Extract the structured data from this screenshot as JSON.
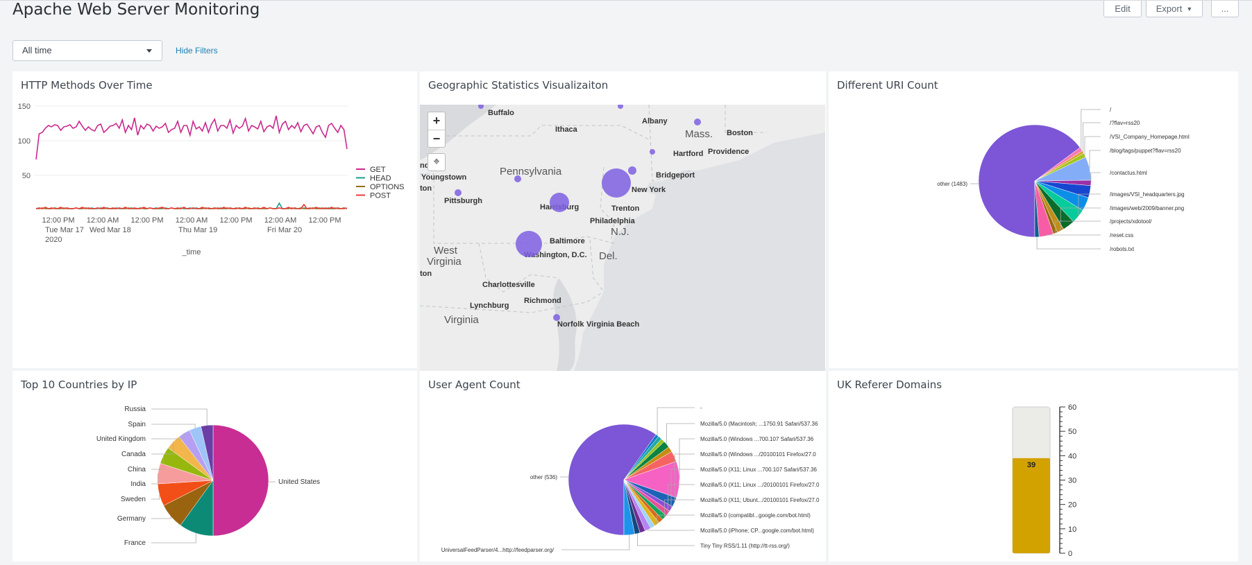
{
  "header": {
    "title": "Apache Web Server Monitoring",
    "edit_label": "Edit",
    "export_label": "Export",
    "more_label": "..."
  },
  "filters": {
    "time_range": "All time",
    "hide_filters": "Hide Filters"
  },
  "panels": {
    "http_methods": {
      "title": "HTTP Methods Over Time",
      "chart_data": {
        "type": "line",
        "xlabel": "_time",
        "ylabel": "",
        "ylim": [
          0,
          150
        ],
        "y_ticks": [
          "150",
          "100",
          "50"
        ],
        "x_ticks": [
          {
            "line1": "12:00 PM",
            "line2": "Tue Mar 17",
            "line3": "2020"
          },
          {
            "line1": "12:00 AM",
            "line2": "Wed Mar 18",
            "line3": ""
          },
          {
            "line1": "12:00 PM",
            "line2": "",
            "line3": ""
          },
          {
            "line1": "12:00 AM",
            "line2": "Thu Mar 19",
            "line3": ""
          },
          {
            "line1": "12:00 PM",
            "line2": "",
            "line3": ""
          },
          {
            "line1": "12:00 AM",
            "line2": "Fri Mar 20",
            "line3": ""
          },
          {
            "line1": "12:00 PM",
            "line2": "",
            "line3": ""
          }
        ],
        "legend_position": "right",
        "series": [
          {
            "name": "GET",
            "color": "#c8298e",
            "values": [
              73,
              110,
              112,
              118,
              122,
              120,
              123,
              122,
              115,
              120,
              121,
              123,
              118,
              120,
              128,
              121,
              115,
              120,
              116,
              114,
              122,
              124,
              112,
              116,
              121,
              122,
              125,
              118,
              130,
              112,
              122,
              116,
              133,
              108,
              122,
              117,
              124,
              122,
              114,
              121,
              118,
              120,
              125,
              112,
              116,
              118,
              128,
              112,
              122,
              122,
              108,
              128,
              117,
              120,
              114,
              126,
              112,
              124,
              131,
              114,
              122,
              122,
              118,
              130,
              111,
              122,
              118,
              121,
              132,
              114,
              122,
              120,
              117,
              128,
              113,
              120,
              122,
              118,
              136,
              112,
              124,
              128,
              116,
              122,
              118,
              126,
              113,
              122,
              124,
              117,
              110,
              120,
              122,
              112,
              105,
              122,
              125,
              118,
              112,
              122,
              116,
              88
            ]
          },
          {
            "name": "HEAD",
            "color": "#1a9c8f",
            "values": [
              2,
              3,
              2,
              3,
              2,
              2,
              3,
              2,
              3,
              2,
              3,
              2,
              2,
              3,
              2,
              2,
              3,
              2,
              3,
              2,
              2,
              3,
              2,
              3,
              2,
              2,
              3,
              2,
              2,
              3,
              2,
              3,
              2,
              2,
              3,
              2,
              2,
              3,
              2,
              3,
              2,
              2,
              3,
              2,
              3,
              2,
              2,
              3,
              2,
              2,
              3,
              2,
              3,
              2,
              2,
              3,
              2,
              2,
              3,
              2,
              3,
              2,
              2,
              3,
              2,
              2,
              3,
              2,
              3,
              2,
              2,
              3,
              2,
              2,
              3,
              2,
              3,
              2,
              2,
              10,
              2,
              2,
              3,
              2,
              3,
              2,
              2,
              3,
              2,
              2,
              3,
              2,
              3,
              2,
              2,
              3,
              2,
              2,
              3,
              2,
              3,
              2
            ]
          },
          {
            "name": "OPTIONS",
            "color": "#956e16",
            "values": [
              2,
              2,
              3,
              2,
              2,
              2,
              3,
              2,
              2,
              3,
              2,
              2,
              2,
              3,
              2,
              2,
              3,
              2,
              2,
              2,
              3,
              2,
              2,
              3,
              2,
              2,
              2,
              3,
              2,
              2,
              3,
              2,
              2,
              2,
              3,
              2,
              2,
              3,
              2,
              2,
              2,
              3,
              2,
              2,
              3,
              2,
              2,
              2,
              3,
              2,
              2,
              3,
              2,
              2,
              2,
              3,
              2,
              2,
              3,
              2,
              2,
              2,
              3,
              2,
              2,
              3,
              2,
              2,
              2,
              3,
              2,
              2,
              3,
              2,
              2,
              2,
              3,
              2,
              2,
              3,
              2,
              2,
              2,
              3,
              2,
              2,
              3,
              2,
              2,
              2,
              3,
              2,
              2,
              3,
              2,
              2,
              2,
              3,
              2,
              2,
              3,
              2
            ]
          },
          {
            "name": "POST",
            "color": "#ec3b37",
            "values": [
              2,
              3,
              2,
              4,
              2,
              3,
              2,
              2,
              4,
              2,
              3,
              2,
              2,
              3,
              2,
              4,
              2,
              3,
              2,
              2,
              3,
              2,
              4,
              2,
              2,
              3,
              2,
              3,
              2,
              4,
              2,
              2,
              3,
              2,
              2,
              4,
              2,
              3,
              2,
              2,
              3,
              4,
              2,
              2,
              3,
              2,
              3,
              2,
              4,
              2,
              2,
              3,
              2,
              2,
              4,
              2,
              3,
              2,
              2,
              3,
              2,
              4,
              2,
              3,
              2,
              2,
              3,
              2,
              4,
              2,
              2,
              3,
              2,
              2,
              4,
              2,
              3,
              2,
              2,
              3,
              2,
              2,
              4,
              2,
              3,
              2,
              2,
              8,
              2,
              3,
              2,
              4,
              2,
              2,
              3,
              2,
              4,
              2,
              3,
              2,
              2,
              3
            ]
          }
        ]
      }
    },
    "geo": {
      "title": "Geographic Statistics Visualizaiton",
      "zoom_in": "+",
      "zoom_out": "−",
      "locate_icon": "⌖",
      "labels": [
        "Buffalo",
        "Albany",
        "Ithaca",
        "Mass.",
        "Boston",
        "Hartford",
        "Providence",
        "Bridgeport",
        "New York",
        "Pennsylvania",
        "Youngstown",
        "Pittsburgh",
        "Harrisburg",
        "Trenton",
        "Philadelphia",
        "N.J.",
        "Baltimore",
        "Washington, D.C.",
        "Del.",
        "West",
        "Virginia",
        "Charlottesville",
        "Richmond",
        "Lynchburg",
        "Virginia",
        "Norfolk",
        "Virginia Beach",
        "nd",
        "ton",
        "ton"
      ]
    },
    "uri": {
      "title": "Different URI Count",
      "chart_data": {
        "type": "pie",
        "slices": [
          {
            "label": "other (1483)",
            "value": 1483,
            "color": "#7c56d6"
          },
          {
            "label": "/",
            "value": 26,
            "color": "#f979b5"
          },
          {
            "label": "/?flav=rss20",
            "value": 18,
            "color": "#d7a32c"
          },
          {
            "label": "/VSI_Company_Homepage.html",
            "value": 28,
            "color": "#a3c41e"
          },
          {
            "label": "/blog/tags/puppet?flav=rss20",
            "value": 155,
            "color": "#84adf7"
          },
          {
            "label": "/contactus.html",
            "value": 35,
            "color": "#9c2fa8"
          },
          {
            "label": "",
            "value": 80,
            "color": "#1747d0"
          },
          {
            "label": "",
            "value": 90,
            "color": "#0c8ee8"
          },
          {
            "label": "/images/VSI_headquarters.jpg",
            "value": 95,
            "color": "#08cb9b"
          },
          {
            "label": "",
            "value": 80,
            "color": "#0a6b2a"
          },
          {
            "label": "/images/web/2009/banner.png",
            "value": 45,
            "color": "#c08d1a"
          },
          {
            "label": "/projects/xdotool/",
            "value": 28,
            "color": "#9a6a0e"
          },
          {
            "label": "/reset.css",
            "value": 95,
            "color": "#f75da4"
          },
          {
            "label": "/robots.txt",
            "value": 28,
            "color": "#0d5f8f"
          }
        ]
      }
    },
    "countries": {
      "title": "Top 10 Countries by IP",
      "chart_data": {
        "type": "pie",
        "slices": [
          {
            "label": "United States",
            "value": 50,
            "color": "#c82d94"
          },
          {
            "label": "France",
            "value": 10,
            "color": "#0d8a76"
          },
          {
            "label": "Germany",
            "value": 7.5,
            "color": "#9a630f"
          },
          {
            "label": "Sweden",
            "value": 6.5,
            "color": "#f14f17"
          },
          {
            "label": "India",
            "value": 6,
            "color": "#f79c9c"
          },
          {
            "label": "China",
            "value": 5,
            "color": "#96b80e"
          },
          {
            "label": "Canada",
            "value": 4.5,
            "color": "#f3b64c"
          },
          {
            "label": "United Kingdom",
            "value": 3.5,
            "color": "#b69ff3"
          },
          {
            "label": "Spain",
            "value": 3.5,
            "color": "#9ec4f8"
          },
          {
            "label": "Russia",
            "value": 3.5,
            "color": "#6a3ea5"
          }
        ]
      }
    },
    "agents": {
      "title": "User Agent Count",
      "chart_data": {
        "type": "pie",
        "slices": [
          {
            "label": "other (536)",
            "value": 536,
            "color": "#7c56d6"
          },
          {
            "label": "-",
            "value": 8,
            "color": "#0d7fc8"
          },
          {
            "label": "",
            "value": 10,
            "color": "#1ea8a8"
          },
          {
            "label": "",
            "value": 10,
            "color": "#9bc225"
          },
          {
            "label": "Mozilla/5.0 (Macintosh; ...1750.91 Safari/537.36",
            "value": 18,
            "color": "#0b8342"
          },
          {
            "label": "",
            "value": 14,
            "color": "#c68d12"
          },
          {
            "label": "",
            "value": 28,
            "color": "#f56462"
          },
          {
            "label": "Mozilla/5.0 (Windows ...700.107 Safari/537.36",
            "value": 95,
            "color": "#f661c4"
          },
          {
            "label": "Mozilla/5.0 (Windows .../20100101 Firefox/27.0",
            "value": 25,
            "color": "#1c63b5"
          },
          {
            "label": "Mozilla/5.0 (X11; Linux ...700.107 Safari/537.36",
            "value": 14,
            "color": "#8e4fd7"
          },
          {
            "label": "Mozilla/5.0 (X11; Linux .../20100101 Firefox/27.0",
            "value": 14,
            "color": "#e65198"
          },
          {
            "label": "Mozilla/5.0 (X11; Ubunt.../20100101 Firefox/27.0",
            "value": 14,
            "color": "#14a45c"
          },
          {
            "label": "",
            "value": 12,
            "color": "#d96a1c"
          },
          {
            "label": "Mozilla/5.0 (compatibl...google.com/bot.html)",
            "value": 14,
            "color": "#dfb21f"
          },
          {
            "label": "",
            "value": 12,
            "color": "#a0d4f5"
          },
          {
            "label": "Mozilla/5.0 (iPhone; CP...google.com/bot.html)",
            "value": 16,
            "color": "#b484f2"
          },
          {
            "label": "",
            "value": 14,
            "color": "#6d2d93"
          },
          {
            "label": "Tiny Tiny RSS/1.11 (http://tt-rss.org/)",
            "value": 14,
            "color": "#16477e"
          },
          {
            "label": "UniversalFeedParser/4...http://feedparser.org/",
            "value": 28,
            "color": "#1f93ea"
          }
        ]
      }
    },
    "uk": {
      "title": "UK Referer Domains",
      "chart_data": {
        "type": "gauge",
        "value": 39,
        "value_label": "39",
        "range": [
          0,
          60
        ],
        "ticks": [
          "60",
          "50",
          "40",
          "30",
          "20",
          "10",
          "0"
        ],
        "fill_color": "#d2a200"
      }
    }
  }
}
